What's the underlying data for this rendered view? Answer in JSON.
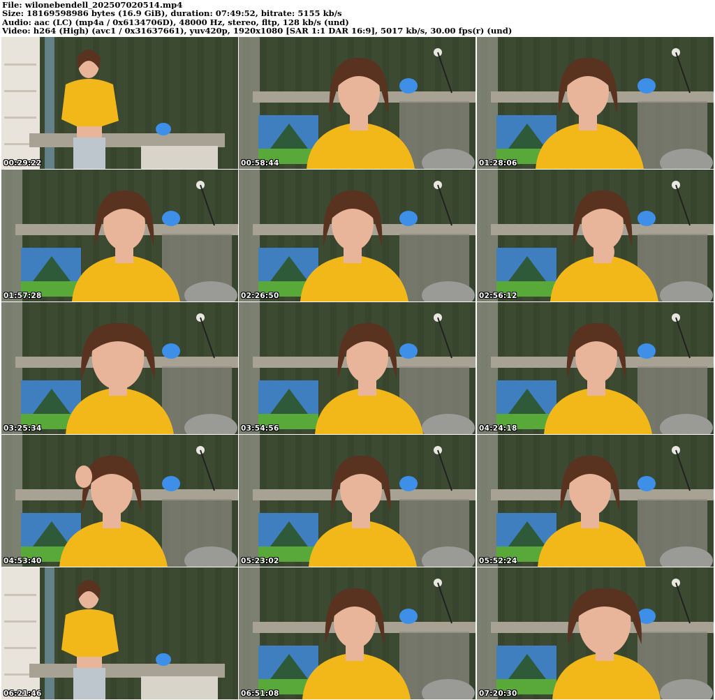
{
  "header": {
    "line1": "File: wilonebendell_202507020514.mp4",
    "line2": "Size: 18169598986 bytes (16.9 GiB), duration: 07:49:52, bitrate: 5155 kb/s",
    "line3": "Audio: aac (LC) (mp4a / 0x6134706D), 48000 Hz, stereo, fltp, 128 kb/s (und)",
    "line4": "Video: h264 (High) (avc1 / 0x31637661), yuv420p, 1920x1080 [SAR 1:1 DAR 16:9], 5017 kb/s, 30.00 fps(r) (und)"
  },
  "thumbnails": [
    {
      "timestamp": "00:29:22",
      "scene": "standing-room-wide"
    },
    {
      "timestamp": "00:58:44",
      "scene": "seated-closeup"
    },
    {
      "timestamp": "01:28:06",
      "scene": "seated-closeup"
    },
    {
      "timestamp": "01:57:28",
      "scene": "seated-closeup"
    },
    {
      "timestamp": "02:26:50",
      "scene": "seated-closeup"
    },
    {
      "timestamp": "02:56:12",
      "scene": "seated-hand-on-chin"
    },
    {
      "timestamp": "03:25:34",
      "scene": "face-closeup"
    },
    {
      "timestamp": "03:54:56",
      "scene": "seated-closeup"
    },
    {
      "timestamp": "04:24:18",
      "scene": "seated-closeup"
    },
    {
      "timestamp": "04:53:40",
      "scene": "seated-hand-in-hair"
    },
    {
      "timestamp": "05:23:02",
      "scene": "seated-closeup"
    },
    {
      "timestamp": "05:52:24",
      "scene": "seated-closeup"
    },
    {
      "timestamp": "06:21:46",
      "scene": "standing-room-wide"
    },
    {
      "timestamp": "06:51:08",
      "scene": "seated-closeup"
    },
    {
      "timestamp": "07:20:30",
      "scene": "face-closeup"
    }
  ],
  "colors": {
    "wall": "#3c4a32",
    "shirt": "#f2b81a",
    "painting_sky": "#3f7fc0",
    "painting_mountain": "#2e5a3a",
    "painting_grass": "#58a83a",
    "cloud_lamp": "#3d8fe8",
    "desk": "#a8a294",
    "hair": "#5a3220",
    "skin": "#e8b49a",
    "shelf": "#e8e4dc",
    "timestamp_text": "#ffffff"
  }
}
